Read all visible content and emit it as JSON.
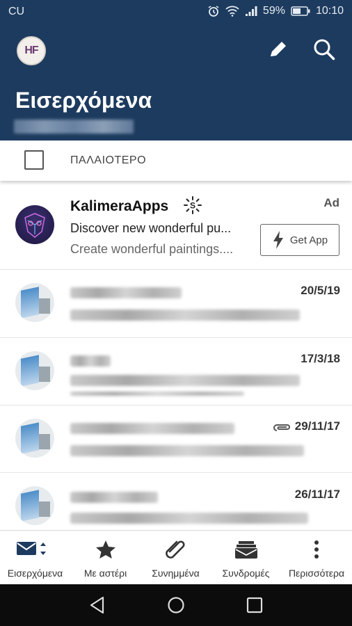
{
  "status": {
    "carrier": "CU",
    "battery": "59%",
    "time": "10:10"
  },
  "header": {
    "avatar_initials": "HF",
    "title": "Εισερχόμενα"
  },
  "filter": {
    "label": "ΠΑΛΑΙΟΤΕΡΟ"
  },
  "ad": {
    "sender": "KalimeraApps",
    "tag": "Ad",
    "subject": "Discover new wonderful pu...",
    "snippet": "Create wonderful paintings....",
    "button": "Get App"
  },
  "emails": [
    {
      "date": "20/5/19"
    },
    {
      "date": "17/3/18"
    },
    {
      "date": "29/11/17",
      "attachment": true
    },
    {
      "date": "26/11/17"
    }
  ],
  "nav": [
    {
      "label": "Εισερχόμενα",
      "icon": "mail-icon"
    },
    {
      "label": "Με αστέρι",
      "icon": "star-icon"
    },
    {
      "label": "Συνημμένα",
      "icon": "paperclip-icon"
    },
    {
      "label": "Συνδρομές",
      "icon": "subscriptions-icon"
    },
    {
      "label": "Περισσότερα",
      "icon": "more-icon"
    }
  ],
  "colors": {
    "header": "#1d3b5e",
    "nav_bar": "#0c0c0c"
  }
}
